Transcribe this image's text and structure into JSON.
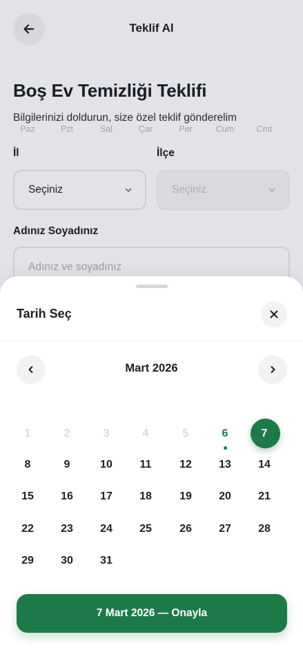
{
  "header": {
    "title": "Teklif Al"
  },
  "page": {
    "title": "Boş Ev Temizliği Teklifi",
    "subtitle": "Bilgilerinizi doldurun, size özel teklif gönderelim"
  },
  "form": {
    "il_label": "İl",
    "il_value": "Seçiniz",
    "ilce_label": "İlçe",
    "ilce_value": "Seçiniz",
    "name_label": "Adınız Soyadınız",
    "name_placeholder": "Adınız ve soyadınız"
  },
  "date_picker": {
    "title": "Tarih Seç",
    "month_label": "Mart 2026",
    "weekdays": [
      "Paz",
      "Pzt",
      "Sal",
      "Çar",
      "Per",
      "Cum",
      "Cmt"
    ],
    "weeks": [
      [
        "1",
        "2",
        "3",
        "4",
        "5",
        "6",
        "7"
      ],
      [
        "8",
        "9",
        "10",
        "11",
        "12",
        "13",
        "14"
      ],
      [
        "15",
        "16",
        "17",
        "18",
        "19",
        "20",
        "21"
      ],
      [
        "22",
        "23",
        "24",
        "25",
        "26",
        "27",
        "28"
      ],
      [
        "29",
        "30",
        "31"
      ]
    ],
    "disabled_days": [
      "1",
      "2",
      "3",
      "4",
      "5"
    ],
    "today": "6",
    "selected": "7",
    "confirm_label": "7 Mart 2026 — Onayla"
  },
  "colors": {
    "accent": "#1d7a48",
    "background": "#f3f4f6",
    "sheet": "#ffffff",
    "disabled_text": "#c9ccd2"
  },
  "icons": {
    "back": "arrow-left-icon",
    "close": "close-icon",
    "prev_month": "chevron-left-icon",
    "next_month": "chevron-right-icon",
    "select": "chevron-down-icon"
  }
}
